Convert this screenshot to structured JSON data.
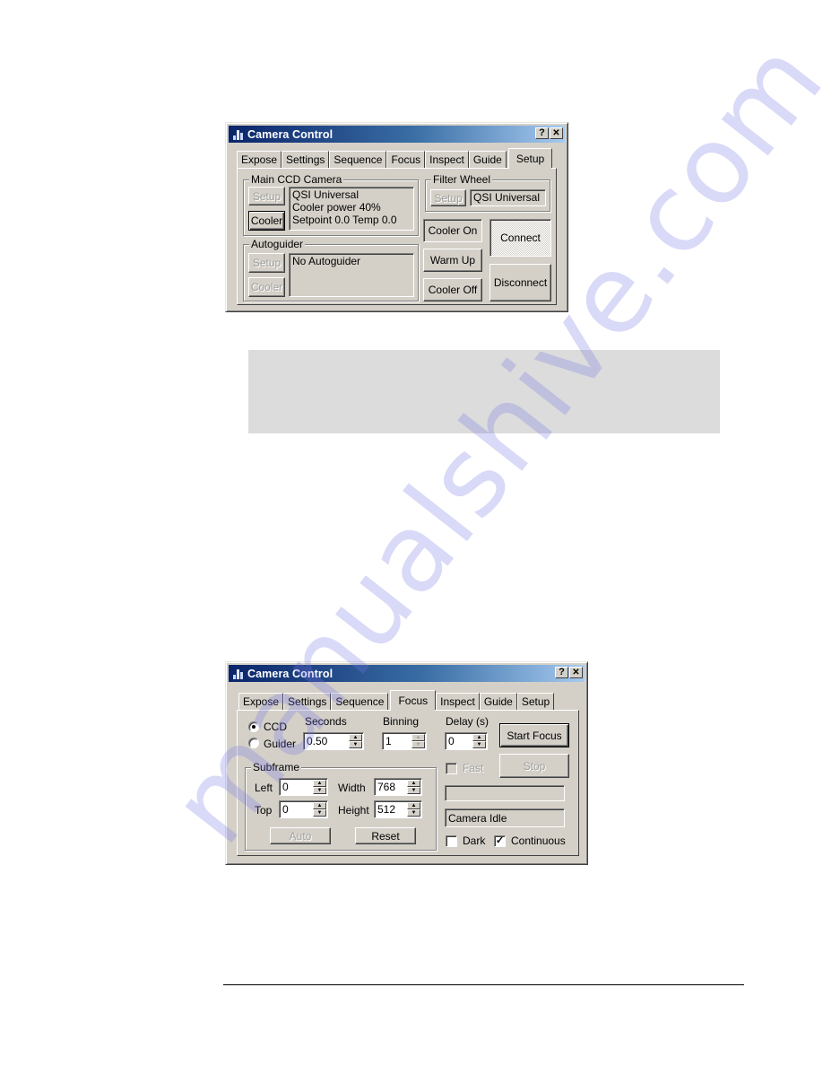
{
  "watermark": "manualshive.com",
  "dialog_setup": {
    "title": "Camera Control",
    "help_button": "?",
    "close_button": "✕",
    "tabs": [
      "Expose",
      "Settings",
      "Sequence",
      "Focus",
      "Inspect",
      "Guide",
      "Setup"
    ],
    "active_tab": "Setup",
    "main_ccd": {
      "group_label": "Main CCD Camera",
      "setup_label": "Setup",
      "cooler_label": "Cooler",
      "status_lines": [
        "QSI Universal",
        "Cooler power 40%",
        "Setpoint 0.0  Temp 0.0"
      ]
    },
    "filter_wheel": {
      "group_label": "Filter Wheel",
      "setup_label": "Setup",
      "status": "QSI Universal"
    },
    "autoguider": {
      "group_label": "Autoguider",
      "setup_label": "Setup",
      "cooler_label": "Cooler",
      "status": "No Autoguider"
    },
    "buttons": {
      "cooler_on": "Cooler On",
      "warm_up": "Warm Up",
      "cooler_off": "Cooler Off",
      "connect": "Connect",
      "disconnect": "Disconnect"
    }
  },
  "dialog_focus": {
    "title": "Camera Control",
    "help_button": "?",
    "close_button": "✕",
    "tabs": [
      "Expose",
      "Settings",
      "Sequence",
      "Focus",
      "Inspect",
      "Guide",
      "Setup"
    ],
    "active_tab": "Focus",
    "camera_select": {
      "options": [
        "CCD",
        "Guider"
      ],
      "selected": "CCD"
    },
    "seconds": {
      "label": "Seconds",
      "value": "0.50"
    },
    "binning": {
      "label": "Binning",
      "value": "1"
    },
    "delay": {
      "label": "Delay (s)",
      "value": "0"
    },
    "subframe": {
      "group_label": "Subframe",
      "left_label": "Left",
      "left_value": "0",
      "top_label": "Top",
      "top_value": "0",
      "width_label": "Width",
      "width_value": "768",
      "height_label": "Height",
      "height_value": "512",
      "auto_label": "Auto",
      "reset_label": "Reset"
    },
    "start_focus_label": "Start Focus",
    "stop_label": "Stop",
    "fast_label": "Fast",
    "fast_checked": false,
    "progress_text": "",
    "status_text": "Camera Idle",
    "dark_label": "Dark",
    "dark_checked": false,
    "continuous_label": "Continuous",
    "continuous_checked": true
  }
}
